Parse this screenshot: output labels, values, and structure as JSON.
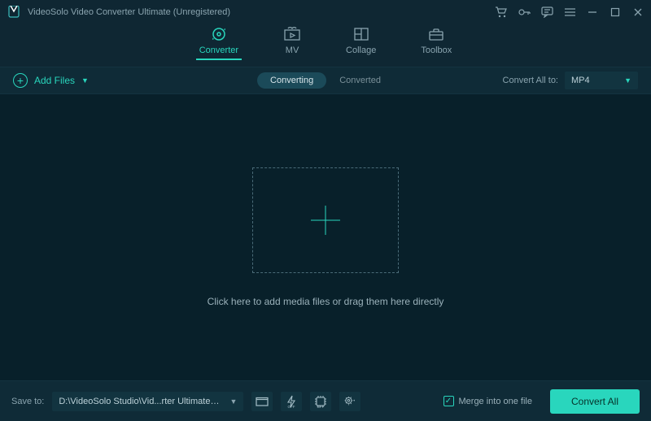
{
  "titlebar": {
    "app_name": "VideoSolo Video Converter Ultimate (Unregistered)"
  },
  "main_tabs": {
    "converter": "Converter",
    "mv": "MV",
    "collage": "Collage",
    "toolbox": "Toolbox"
  },
  "sub_bar": {
    "add_files": "Add Files",
    "converting": "Converting",
    "converted": "Converted",
    "convert_all_to_label": "Convert All to:",
    "format_selected": "MP4"
  },
  "workspace": {
    "drop_text": "Click here to add media files or drag them here directly"
  },
  "bottom": {
    "save_to_label": "Save to:",
    "save_path": "D:\\VideoSolo Studio\\Vid...rter Ultimate\\Converted",
    "merge_label": "Merge into one file",
    "convert_button": "Convert All"
  }
}
